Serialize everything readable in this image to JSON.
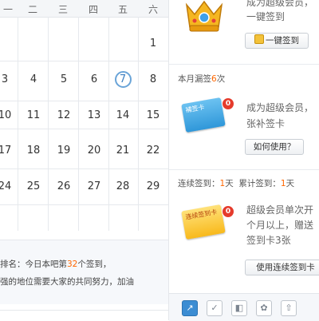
{
  "calendar": {
    "weekdays": [
      "一",
      "二",
      "三",
      "四",
      "五",
      "六"
    ],
    "rows": [
      [
        "",
        "",
        "",
        "",
        "",
        "1"
      ],
      [
        "3",
        "4",
        "5",
        "6",
        "7",
        "8"
      ],
      [
        "10",
        "11",
        "12",
        "13",
        "14",
        "15"
      ],
      [
        "17",
        "18",
        "19",
        "20",
        "21",
        "22"
      ],
      [
        "24",
        "25",
        "26",
        "27",
        "28",
        "29"
      ]
    ],
    "today": "7"
  },
  "rank": {
    "line1_a": "排名：今日本吧第",
    "line1_num": "32",
    "line1_b": "个签到，",
    "line2": "强的地位需要大家的共同努力，加油"
  },
  "side": {
    "top": {
      "desc_line1": "成为超级会员，",
      "desc_line2": "一键签到",
      "button": "一键签到"
    },
    "missed": {
      "title_a": "本月漏签",
      "count": "6",
      "title_b": "次",
      "card_label": "補签卡",
      "badge": "0",
      "desc_line1": "成为超级会员，",
      "desc_line2": "张补签卡",
      "button": "如何使用？"
    },
    "streak": {
      "label_a": "连续签到：",
      "days": "1",
      "unit_a": "天",
      "label_b": "累计签到：",
      "total": "1",
      "unit_b": "天",
      "card_label": "连续签到卡",
      "badge": "0",
      "desc_line1": "超级会员单次开",
      "desc_line2": "个月以上，赠送",
      "desc_line3": "签到卡3张",
      "button": "使用连续签到卡"
    }
  },
  "toolbar": {
    "icons": [
      "share-icon",
      "sign-icon",
      "tb-icon",
      "settings-icon",
      "upload-icon"
    ]
  },
  "colors": {
    "accent": "#ff6600",
    "ring": "#6aa4d8",
    "badge": "#e53b2c"
  }
}
